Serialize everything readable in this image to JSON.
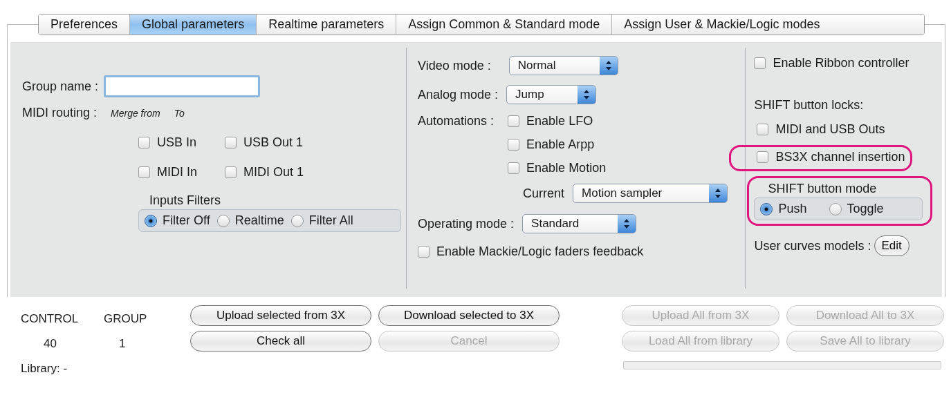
{
  "tabs": [
    {
      "label": "Preferences",
      "selected": false
    },
    {
      "label": "Global parameters",
      "selected": true
    },
    {
      "label": "Realtime parameters",
      "selected": false
    },
    {
      "label": "Assign Common & Standard mode",
      "selected": false
    },
    {
      "label": "Assign User & Mackie/Logic modes",
      "selected": false
    }
  ],
  "group_name": {
    "label": "Group name :"
  },
  "midi_routing": {
    "label": "MIDI routing :",
    "merge_from": "Merge from",
    "to": "To",
    "checkboxes": [
      {
        "label": "USB In",
        "checked": false
      },
      {
        "label": "USB Out 1",
        "checked": false
      },
      {
        "label": "MIDI In",
        "checked": false
      },
      {
        "label": "MIDI Out 1",
        "checked": false
      }
    ]
  },
  "inputs_filters": {
    "title": "Inputs Filters",
    "options": [
      {
        "label": "Filter Off",
        "selected": true
      },
      {
        "label": "Realtime",
        "selected": false
      },
      {
        "label": "Filter All",
        "selected": false
      }
    ]
  },
  "video_mode": {
    "label": "Video mode :",
    "value": "Normal"
  },
  "analog_mode": {
    "label": "Analog mode :",
    "value": "Jump"
  },
  "automations": {
    "label": "Automations :",
    "checkboxes": [
      {
        "label": "Enable LFO",
        "checked": false
      },
      {
        "label": "Enable Arpp",
        "checked": false
      },
      {
        "label": "Enable Motion",
        "checked": false
      }
    ],
    "current": {
      "label": "Current",
      "value": "Motion sampler"
    }
  },
  "operating_mode": {
    "label": "Operating mode :",
    "value": "Standard"
  },
  "mackie_feedback": {
    "label": "Enable Mackie/Logic faders feedback",
    "checked": false
  },
  "ribbon": {
    "label": "Enable Ribbon controller",
    "checked": false
  },
  "shift_locks": {
    "title": "SHIFT button locks:",
    "checkboxes": [
      {
        "label": "MIDI and USB Outs",
        "checked": false
      },
      {
        "label": "BS3X channel insertion",
        "checked": false,
        "highlighted": true
      }
    ]
  },
  "shift_mode": {
    "title": "SHIFT button mode",
    "highlighted": true,
    "options": [
      {
        "label": "Push",
        "selected": true
      },
      {
        "label": "Toggle",
        "selected": false
      }
    ]
  },
  "user_curves": {
    "label": "User curves models :",
    "button": "Edit"
  },
  "status": {
    "columns": [
      "CONTROL",
      "GROUP"
    ],
    "values": [
      "40",
      "1"
    ],
    "library": "Library: -"
  },
  "actions": [
    {
      "label": "Upload selected from 3X",
      "disabled": false
    },
    {
      "label": "Download selected to 3X",
      "disabled": false
    },
    {
      "label": "Check all",
      "disabled": false
    },
    {
      "label": "Cancel",
      "disabled": true
    }
  ],
  "library_actions": [
    {
      "label": "Upload All from 3X",
      "disabled": true
    },
    {
      "label": "Download All to 3X",
      "disabled": true
    },
    {
      "label": "Load All from library",
      "disabled": true
    },
    {
      "label": "Save All to library",
      "disabled": true
    }
  ],
  "progress": {
    "level": 0
  }
}
